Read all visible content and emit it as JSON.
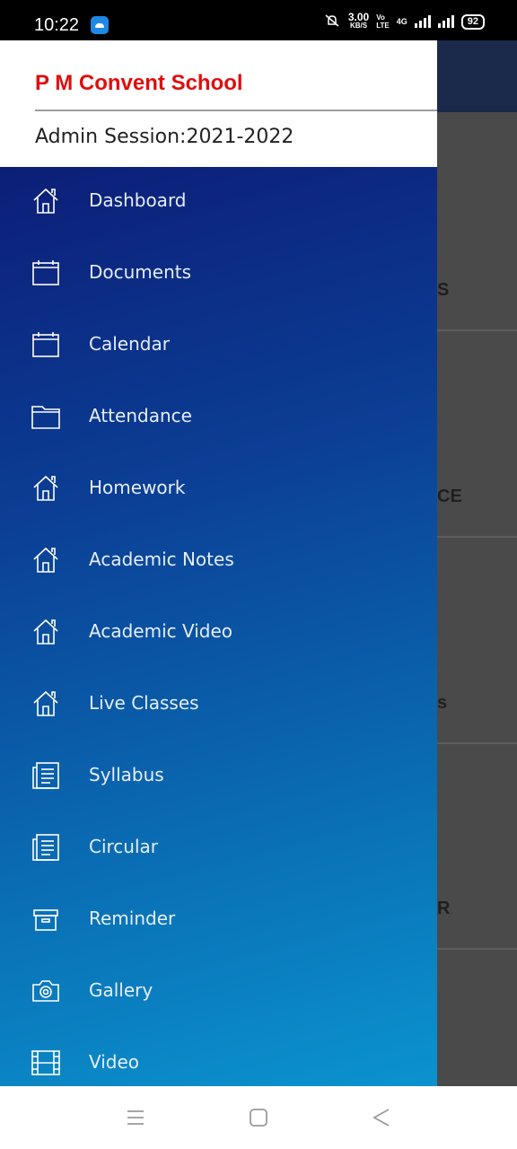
{
  "status_bar": {
    "time": "10:22",
    "speed_value": "3.00",
    "speed_unit": "KB/S",
    "volte_top": "Vo",
    "volte_bottom": "LTE",
    "network": "4G",
    "battery": "92",
    "icons": [
      "app-notification-icon",
      "mute-icon",
      "signal-icon",
      "battery-icon"
    ]
  },
  "drawer": {
    "school_name": "P M Convent School",
    "session": "Admin Session:2021-2022",
    "school_name_color": "#e10d0d",
    "menu_items": [
      {
        "label": "Dashboard",
        "icon": "home-icon"
      },
      {
        "label": "Documents",
        "icon": "calendar-icon"
      },
      {
        "label": "Calendar",
        "icon": "calendar-icon"
      },
      {
        "label": "Attendance",
        "icon": "folder-icon"
      },
      {
        "label": "Homework",
        "icon": "home-icon"
      },
      {
        "label": "Academic Notes",
        "icon": "home-icon"
      },
      {
        "label": "Academic Video",
        "icon": "home-icon"
      },
      {
        "label": "Live Classes",
        "icon": "home-icon"
      },
      {
        "label": "Syllabus",
        "icon": "document-icon"
      },
      {
        "label": "Circular",
        "icon": "document-icon"
      },
      {
        "label": "Reminder",
        "icon": "archive-icon"
      },
      {
        "label": "Gallery",
        "icon": "camera-icon"
      },
      {
        "label": "Video",
        "icon": "film-icon"
      }
    ]
  },
  "background": {
    "fragments": [
      "S",
      "CE",
      "s",
      "R"
    ]
  },
  "navbar": {
    "buttons": [
      "menu-button",
      "home-button",
      "back-button"
    ]
  }
}
